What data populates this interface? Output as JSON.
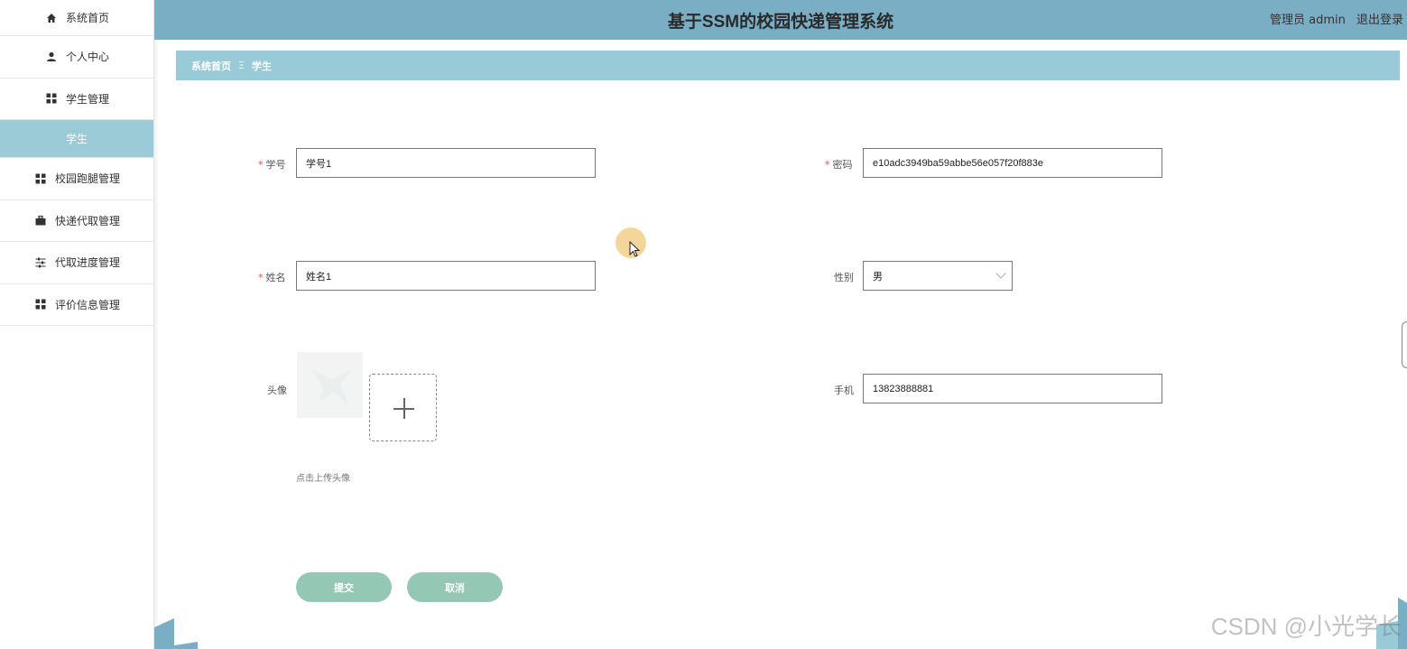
{
  "app": {
    "title": "基于SSM的校园快递管理系统",
    "user_label": "管理员 admin",
    "logout_label": "退出登录"
  },
  "sidebar": {
    "items": [
      {
        "label": "系统首页",
        "icon": "home-icon"
      },
      {
        "label": "个人中心",
        "icon": "user-icon"
      },
      {
        "label": "学生管理",
        "icon": "grid-icon"
      },
      {
        "label": "学生",
        "icon": ""
      },
      {
        "label": "校园跑腿管理",
        "icon": "grid-icon"
      },
      {
        "label": "快递代取管理",
        "icon": "briefcase-icon"
      },
      {
        "label": "代取进度管理",
        "icon": "sliders-icon"
      },
      {
        "label": "评价信息管理",
        "icon": "grid-icon"
      }
    ]
  },
  "breadcrumb": {
    "home": "系统首页",
    "separator": "Ξ",
    "current": "学生"
  },
  "form": {
    "student_id": {
      "label": "学号",
      "value": "学号1"
    },
    "password": {
      "label": "密码",
      "value": "e10adc3949ba59abbe56e057f20f883e"
    },
    "name": {
      "label": "姓名",
      "value": "姓名1"
    },
    "gender": {
      "label": "性别",
      "value": "男"
    },
    "avatar": {
      "label": "头像",
      "hint": "点击上传头像"
    },
    "phone": {
      "label": "手机",
      "value": "13823888881"
    },
    "submit_label": "提交",
    "cancel_label": "取消"
  },
  "watermark": "CSDN @小光学长",
  "colors": {
    "topbar": "#79aec5",
    "breadcrumb": "#98cad7",
    "active_sidebar": "#9ccbd8",
    "button": "#94c7b4"
  }
}
